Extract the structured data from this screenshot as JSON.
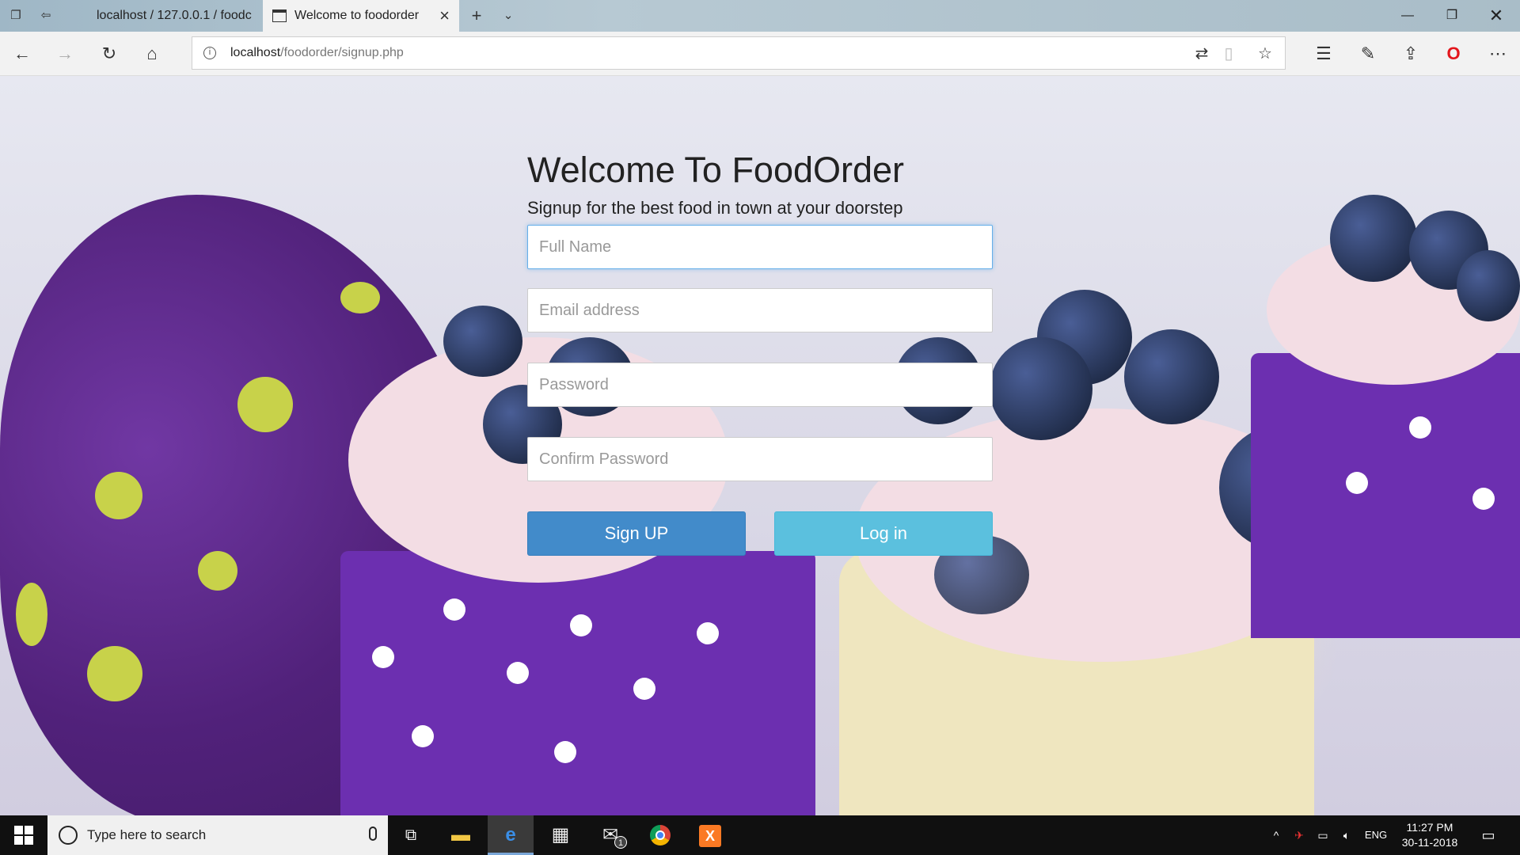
{
  "browser": {
    "tabs": [
      {
        "title": "localhost / 127.0.0.1 / foodc",
        "active": false
      },
      {
        "title": "Welcome to foodorder",
        "active": true
      }
    ],
    "address": {
      "host": "localhost",
      "path": "/foodorder/signup.php"
    }
  },
  "page": {
    "heading": "Welcome To FoodOrder",
    "subheading": "Signup for the best food in town at your doorstep",
    "fields": {
      "full_name_placeholder": "Full Name",
      "email_placeholder": "Email address",
      "password_placeholder": "Password",
      "confirm_password_placeholder": "Confirm Password"
    },
    "buttons": {
      "signup": "Sign UP",
      "login": "Log in"
    },
    "colors": {
      "signup_button": "#428bca",
      "login_button": "#5bc0de"
    }
  },
  "taskbar": {
    "search_placeholder": "Type here to search",
    "mail_badge": "1",
    "language": "ENG",
    "time": "11:27 PM",
    "date": "30-11-2018"
  }
}
